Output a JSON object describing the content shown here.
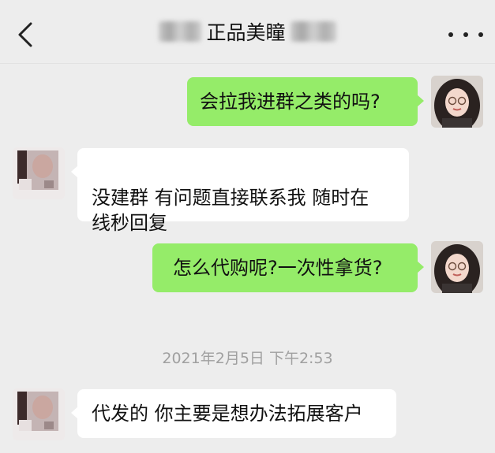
{
  "header": {
    "title": "正品美瞳",
    "back_icon": "chevron-left-icon",
    "more_icon": "more-dots-icon"
  },
  "messages": [
    {
      "from": "me",
      "text": "会拉我进群之类的吗?"
    },
    {
      "from": "them",
      "text": "没建群 有问题直接联系我 随时在\n线秒回复"
    },
    {
      "from": "me",
      "text": "怎么代购呢?一次性拿货?"
    },
    {
      "from": "them",
      "text": "代发的 你主要是想办法拓展客户"
    }
  ],
  "timestamp": "2021年2月5日 下午2:53",
  "colors": {
    "background": "#ededed",
    "my_bubble": "#95ec69",
    "their_bubble": "#ffffff",
    "timestamp": "#a0a0a0"
  }
}
